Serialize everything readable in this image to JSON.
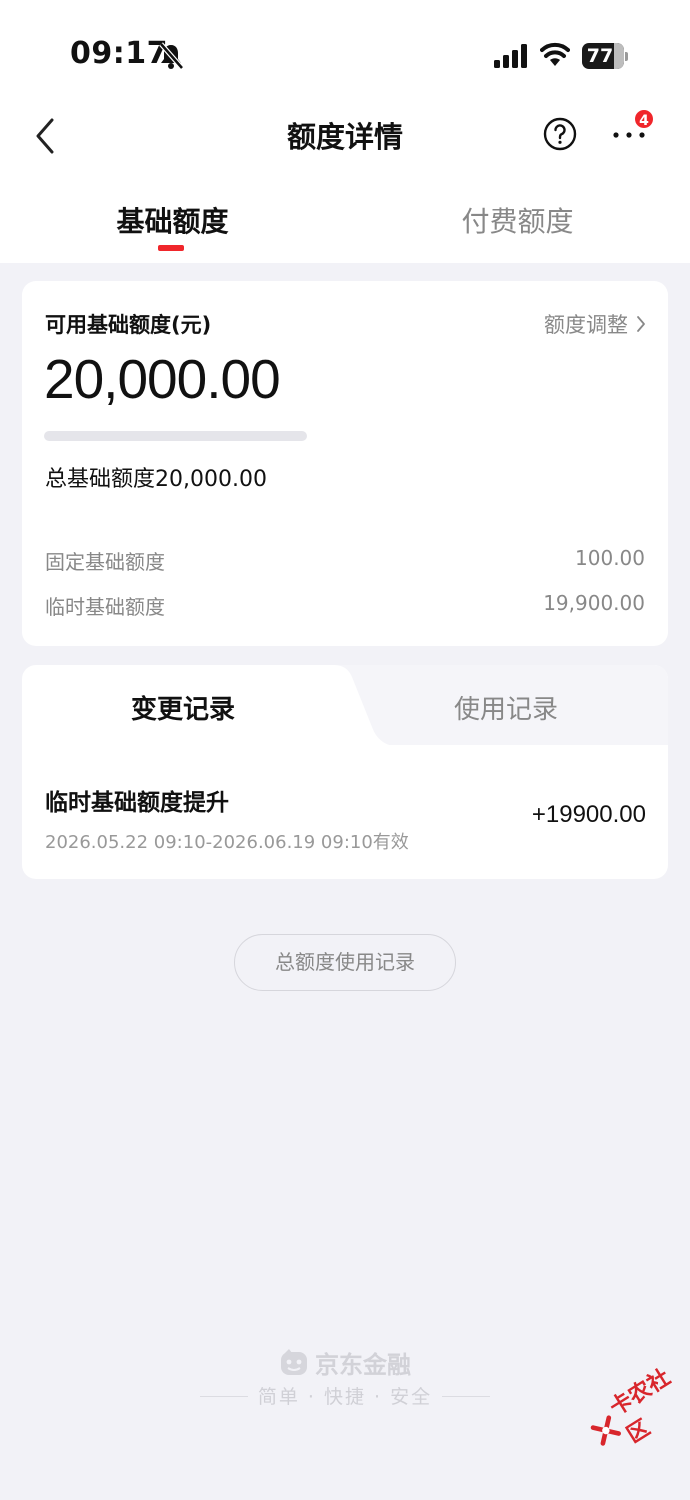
{
  "status_bar": {
    "time": "09:17",
    "battery": "77",
    "battery_level": 0.77
  },
  "nav": {
    "title": "额度详情",
    "notification_count": "4"
  },
  "tabs": [
    {
      "label": "基础额度",
      "active": true
    },
    {
      "label": "付费额度",
      "active": false
    }
  ],
  "limit_card": {
    "title": "可用基础额度(元)",
    "adjust_label": "额度调整",
    "available_amount": "20,000.00",
    "usage_fraction": 0,
    "total_label": "总基础额度20,000.00",
    "rows": [
      {
        "label": "固定基础额度",
        "value": "100.00"
      },
      {
        "label": "临时基础额度",
        "value": "19,900.00"
      }
    ]
  },
  "records": {
    "tabs": [
      {
        "label": "变更记录",
        "active": true
      },
      {
        "label": "使用记录",
        "active": false
      }
    ],
    "items": [
      {
        "title": "临时基础额度提升",
        "period": "2026.05.22 09:10-2026.06.19 09:10有效",
        "amount": "+19900.00"
      }
    ]
  },
  "usage_button_label": "总额度使用记录",
  "footer": {
    "brand": "京东金融",
    "slogan": "简单 · 快捷 · 安全"
  },
  "watermark": "卡农社区",
  "colors": {
    "accent": "#f0262b",
    "page_background": "#f2f2f7"
  }
}
